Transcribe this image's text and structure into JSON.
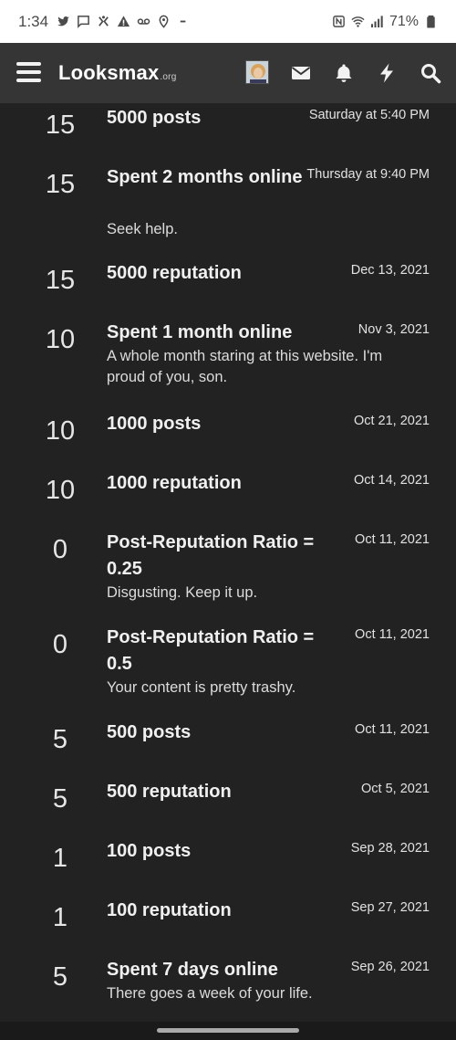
{
  "status_bar": {
    "time": "1:34",
    "battery": "71%"
  },
  "header": {
    "logo_main": "Looksmax",
    "logo_tld": ".org",
    "icons": [
      "menu-icon",
      "envelope-icon",
      "bell-icon",
      "bolt-icon",
      "search-icon"
    ]
  },
  "trophies": [
    {
      "points": "15",
      "title": "5000 posts",
      "date": "Saturday at 5:40 PM",
      "desc": ""
    },
    {
      "points": "15",
      "title": "Spent 2 months online",
      "date": "Thursday at 9:40 PM",
      "desc": "Seek help."
    },
    {
      "points": "15",
      "title": "5000 reputation",
      "date": "Dec 13, 2021",
      "desc": ""
    },
    {
      "points": "10",
      "title": "Spent 1 month online",
      "date": "Nov 3, 2021",
      "desc": "A whole month staring at this website. I'm proud of you, son."
    },
    {
      "points": "10",
      "title": "1000 posts",
      "date": "Oct 21, 2021",
      "desc": ""
    },
    {
      "points": "10",
      "title": "1000 reputation",
      "date": "Oct 14, 2021",
      "desc": ""
    },
    {
      "points": "0",
      "title": "Post-Reputation Ratio = 0.25",
      "date": "Oct 11, 2021",
      "desc": "Disgusting. Keep it up."
    },
    {
      "points": "0",
      "title": "Post-Reputation Ratio = 0.5",
      "date": "Oct 11, 2021",
      "desc": "Your content is pretty trashy."
    },
    {
      "points": "5",
      "title": "500 posts",
      "date": "Oct 11, 2021",
      "desc": ""
    },
    {
      "points": "5",
      "title": "500 reputation",
      "date": "Oct 5, 2021",
      "desc": ""
    },
    {
      "points": "1",
      "title": "100 posts",
      "date": "Sep 28, 2021",
      "desc": ""
    },
    {
      "points": "1",
      "title": "100 reputation",
      "date": "Sep 27, 2021",
      "desc": ""
    },
    {
      "points": "5",
      "title": "Spent 7 days online",
      "date": "Sep 26, 2021",
      "desc": "There goes a week of your life."
    }
  ]
}
